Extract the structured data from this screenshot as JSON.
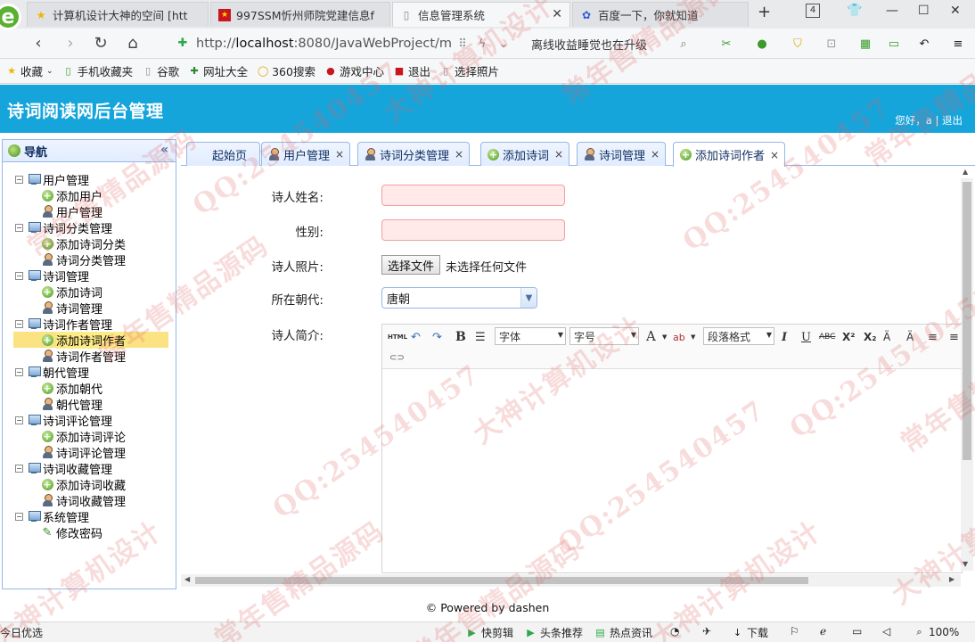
{
  "browser": {
    "tabs": [
      {
        "title": "计算机设计大神的空间 [htt",
        "icon": "star-icon"
      },
      {
        "title": "997SSM忻州师院党建信息f",
        "icon": "flag-icon"
      },
      {
        "title": "信息管理系统",
        "icon": "page-icon"
      },
      {
        "title": "百度一下，你就知道",
        "icon": "paw-icon"
      }
    ],
    "tab_count": "4",
    "url_prefix": "http://",
    "url_host": "localhost",
    "url_rest": ":8080/JavaWebProject/m",
    "search_text": "离线收益睡觉也在升级",
    "bookmarks": [
      "收藏",
      "手机收藏夹",
      "谷歌",
      "网址大全",
      "360搜索",
      "游戏中心",
      "退出",
      "选择照片"
    ]
  },
  "app": {
    "title": "诗词阅读网后台管理",
    "greeting": "您好，a",
    "separator": "|",
    "logout": "退出"
  },
  "nav": {
    "title": "导航",
    "collapse": "«",
    "groups": [
      {
        "label": "用户管理",
        "items": [
          {
            "label": "添加用户",
            "icon": "add"
          },
          {
            "label": "用户管理",
            "icon": "user"
          }
        ]
      },
      {
        "label": "诗词分类管理",
        "items": [
          {
            "label": "添加诗词分类",
            "icon": "add"
          },
          {
            "label": "诗词分类管理",
            "icon": "user"
          }
        ]
      },
      {
        "label": "诗词管理",
        "items": [
          {
            "label": "添加诗词",
            "icon": "add"
          },
          {
            "label": "诗词管理",
            "icon": "user"
          }
        ]
      },
      {
        "label": "诗词作者管理",
        "items": [
          {
            "label": "添加诗词作者",
            "icon": "add",
            "selected": true
          },
          {
            "label": "诗词作者管理",
            "icon": "user"
          }
        ]
      },
      {
        "label": "朝代管理",
        "items": [
          {
            "label": "添加朝代",
            "icon": "add"
          },
          {
            "label": "朝代管理",
            "icon": "user"
          }
        ]
      },
      {
        "label": "诗词评论管理",
        "items": [
          {
            "label": "添加诗词评论",
            "icon": "add"
          },
          {
            "label": "诗词评论管理",
            "icon": "user"
          }
        ]
      },
      {
        "label": "诗词收藏管理",
        "items": [
          {
            "label": "添加诗词收藏",
            "icon": "add"
          },
          {
            "label": "诗词收藏管理",
            "icon": "user"
          }
        ]
      },
      {
        "label": "系统管理",
        "items": [
          {
            "label": "修改密码",
            "icon": "pencil"
          }
        ]
      }
    ]
  },
  "tabs": [
    {
      "label": "起始页",
      "icon": "",
      "closable": false
    },
    {
      "label": "用户管理",
      "icon": "user",
      "closable": true
    },
    {
      "label": "诗词分类管理",
      "icon": "user",
      "closable": true
    },
    {
      "label": "添加诗词",
      "icon": "add",
      "closable": true
    },
    {
      "label": "诗词管理",
      "icon": "user",
      "closable": true
    },
    {
      "label": "添加诗词作者",
      "icon": "add",
      "closable": true,
      "active": true
    }
  ],
  "form": {
    "name_label": "诗人姓名:",
    "name_value": "",
    "sex_label": "性别:",
    "sex_value": "",
    "photo_label": "诗人照片:",
    "photo_button": "选择文件",
    "photo_status": "未选择任何文件",
    "dynasty_label": "所在朝代:",
    "dynasty_value": "唐朝",
    "intro_label": "诗人简介:",
    "editor": {
      "html": "HTML",
      "bold": "B",
      "font_family": "字体",
      "font_size": "字号",
      "font_color": "A",
      "paragraph": "段落格式",
      "italic": "I",
      "underline": "U",
      "strike": "ABC",
      "superscript": "X²",
      "subscript": "X₂"
    }
  },
  "footer": "© Powered by dashen",
  "statusbar": {
    "left": "今日优选",
    "items": [
      "快剪辑",
      "头条推荐",
      "热点资讯"
    ],
    "download": "下载",
    "zoom": "100%"
  },
  "watermark": [
    "QQ:254540457",
    "大神计算机设计",
    "常年售精品源码"
  ]
}
